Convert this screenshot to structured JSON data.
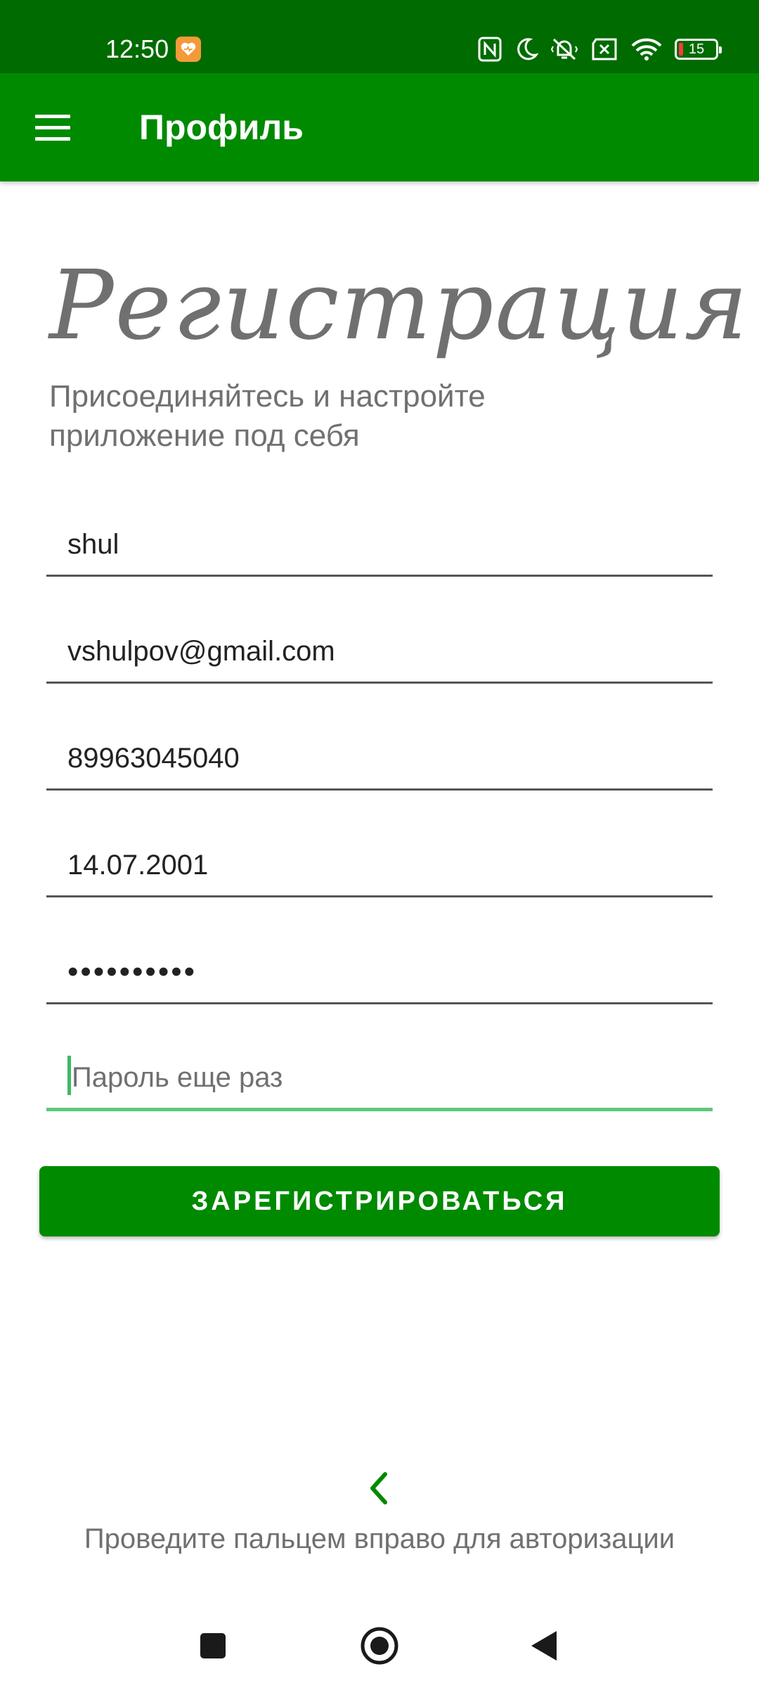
{
  "status_bar": {
    "time": "12:50",
    "battery_level": "15",
    "icons": [
      "health-notification-icon",
      "nfc-icon",
      "moon-icon",
      "vibrate-off-icon",
      "sim-x-icon",
      "wifi-icon",
      "battery-icon"
    ]
  },
  "app_bar": {
    "title": "Профиль",
    "menu_icon": "hamburger-menu-icon"
  },
  "form": {
    "heading": "Регистрация",
    "subheading": "Присоединяйтесь и настройте приложение под себя",
    "fields": {
      "name": "shul",
      "email": "vshulpov@gmail.com",
      "phone": "89963045040",
      "birthdate": "14.07.2001",
      "password": "••••••••••",
      "password_repeat_placeholder": "Пароль еще раз"
    },
    "register_button": "ЗАРЕГИСТРИРОВАТЬСЯ"
  },
  "swipe_hint": {
    "text": "Проведите пальцем вправо для авторизации",
    "icon": "chevron-left-icon"
  },
  "navbar": {
    "icons": [
      "recents-square-icon",
      "home-circle-icon",
      "back-triangle-icon"
    ]
  },
  "colors": {
    "status_bar": "#006b00",
    "app_bar": "#008a00",
    "accent": "#5ac97a",
    "muted_text": "#707070"
  }
}
